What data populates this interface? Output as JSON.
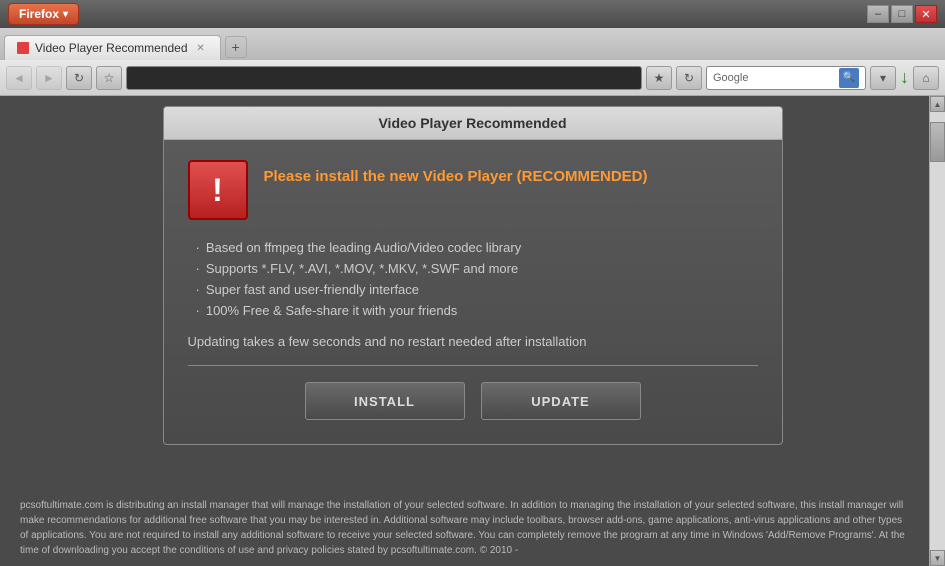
{
  "titlebar": {
    "firefox_label": "Firefox",
    "minimize_label": "–",
    "maximize_label": "□",
    "close_label": "✕"
  },
  "tab": {
    "label": "Video Player Recommended",
    "new_tab_label": "+"
  },
  "navbar": {
    "back_label": "◄",
    "forward_label": "►",
    "reload_label": "↻",
    "url_value": "",
    "search_placeholder": "Google",
    "home_label": "⌂",
    "download_label": "↓"
  },
  "dialog": {
    "title": "Video Player Recommended",
    "heading": "Please install the new Video Player ",
    "heading_recommended": "(RECOMMENDED)",
    "bullet1": "Based on ffmpeg the leading Audio/Video codec library",
    "bullet2": "Supports *.FLV, *.AVI, *.MOV, *.MKV, *.SWF and more",
    "bullet3": "Super fast and user-friendly interface",
    "bullet4": "100% Free & Safe-share it with your friends",
    "update_note": "Updating takes a few seconds and no restart needed after installation",
    "install_label": "INSTALL",
    "update_label": "UPDATE"
  },
  "footer": {
    "text": "pcsoftultimate.com is distributing an install manager that will manage the installation of your selected software. In addition to managing the installation of your selected software, this install manager will make recommendations for additional free software that you may be interested in. Additional software may include toolbars, browser add-ons, game applications, anti-virus applications and other types of applications. You are not required to install any additional software to receive your selected software. You can completely remove the program at any time in Windows 'Add/Remove Programs'. At the time of downloading you accept the conditions of use and privacy policies stated by pcsoftultimate.com. © 2010 -"
  },
  "icons": {
    "warning": "!",
    "scroll_up": "▲",
    "scroll_down": "▼"
  }
}
